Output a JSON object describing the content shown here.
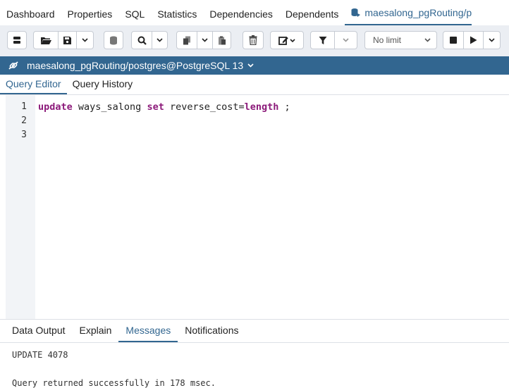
{
  "nav": {
    "tabs": [
      "Dashboard",
      "Properties",
      "SQL",
      "Statistics",
      "Dependencies",
      "Dependents"
    ],
    "active_tab": "maesalong_pgRouting/p"
  },
  "toolbar": {
    "icons": [
      "server-icon",
      "folder-open-icon",
      "save-icon",
      "chevron-down-icon",
      "database-icon",
      "search-icon",
      "copy-icon",
      "paste-icon",
      "delete-icon",
      "edit-icon",
      "filter-icon",
      "stop-icon",
      "play-icon"
    ],
    "limit_value": "No limit"
  },
  "connection": {
    "label": "maesalong_pgRouting/postgres@PostgreSQL 13"
  },
  "editor_tabs": [
    "Query Editor",
    "Query History"
  ],
  "editor": {
    "line_numbers": [
      "1",
      "2",
      "3"
    ],
    "tokens": {
      "kw_update": "update",
      "t1": " ways_salong ",
      "kw_set": "set",
      "t2": " reverse_cost=",
      "kw_length": "length",
      "t3": " ;"
    }
  },
  "output_tabs": [
    "Data Output",
    "Explain",
    "Messages",
    "Notifications"
  ],
  "messages": [
    "UPDATE 4078",
    "Query returned successfully in 178 msec."
  ],
  "colors": {
    "accent": "#326690",
    "toolbar_bg": "#ebeef3",
    "keyword": "#8c1a7a"
  }
}
